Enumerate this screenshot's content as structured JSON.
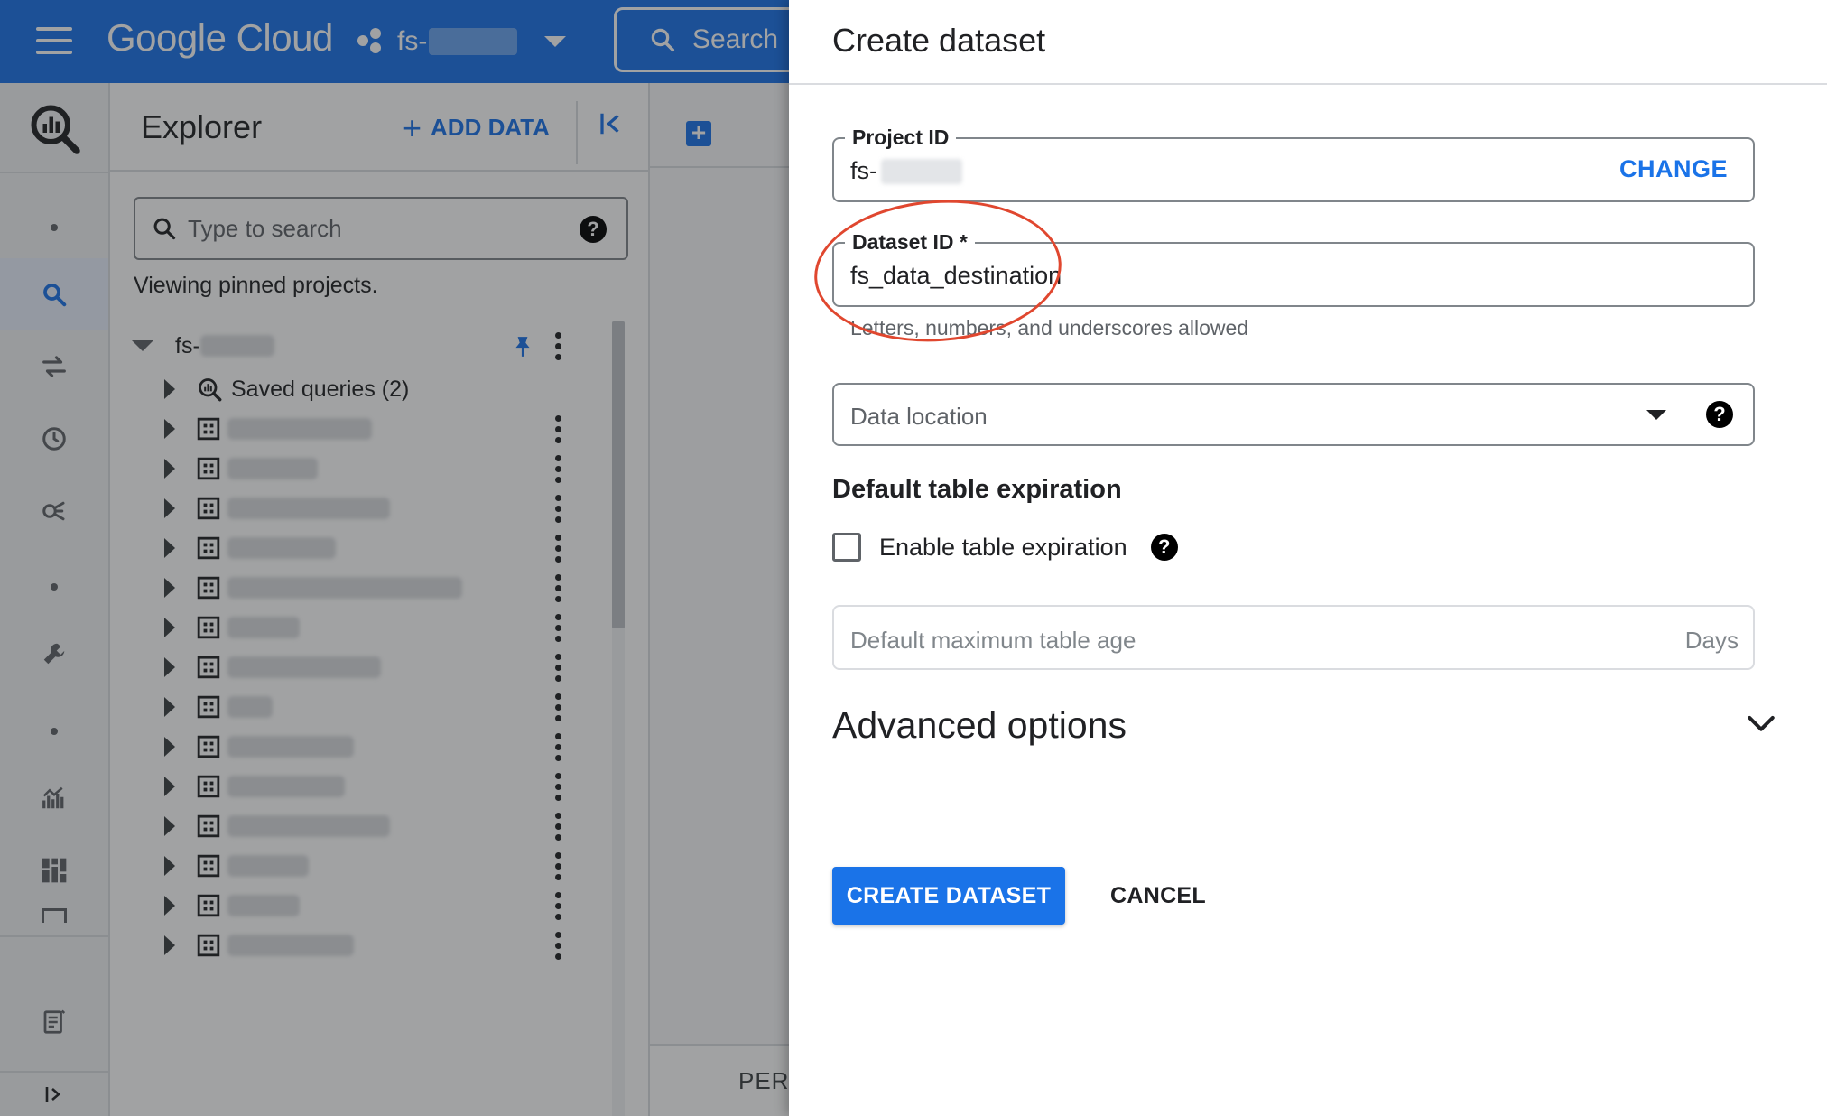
{
  "topbar": {
    "brand": "Google Cloud",
    "project": "fs-",
    "search_label": "Search"
  },
  "explorer": {
    "title": "Explorer",
    "add_data_label": "ADD DATA",
    "search_placeholder": "Type to search",
    "viewing_text": "Viewing pinned projects.",
    "root_project": "fs-",
    "saved_queries": "Saved queries (2)",
    "dataset_rows": 14
  },
  "workspace": {
    "bottom_tab": "PERS"
  },
  "panel": {
    "title": "Create dataset",
    "project_id": {
      "label": "Project ID",
      "value": "fs-",
      "change_label": "CHANGE"
    },
    "dataset_id": {
      "label": "Dataset ID *",
      "value": "fs_data_destination",
      "hint": "Letters, numbers, and underscores allowed"
    },
    "data_location": {
      "placeholder": "Data location"
    },
    "expiration": {
      "heading": "Default table expiration",
      "checkbox_label": "Enable table expiration",
      "checked": false,
      "max_age_placeholder": "Default maximum table age",
      "max_age_suffix": "Days"
    },
    "advanced_label": "Advanced options",
    "create_label": "CREATE DATASET",
    "cancel_label": "CANCEL"
  },
  "colors": {
    "accent": "#1a73e8",
    "annotation_circle": "#e0472f"
  },
  "icons": [
    "menu-icon",
    "project-icon",
    "search-icon",
    "bigquery-logo-icon",
    "plus-icon",
    "collapse-left-icon",
    "help-icon",
    "pin-icon",
    "more-vert-icon",
    "dataset-icon",
    "chevron-down-icon",
    "expand-icon"
  ]
}
